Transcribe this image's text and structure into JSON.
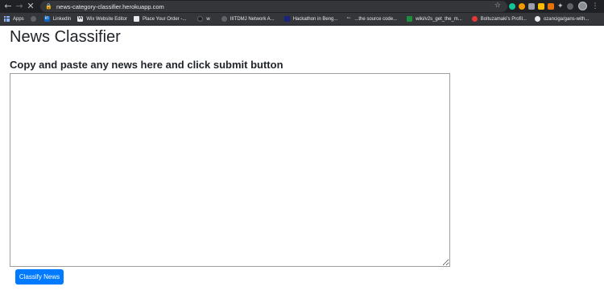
{
  "browser": {
    "url": "news-category-classifier.herokuapp.com",
    "bookmarks": [
      {
        "label": "Apps",
        "icon": "apps-grid-icon",
        "color": "#8ab4f8"
      },
      {
        "label": "",
        "icon": "globe-icon",
        "color": "#bdc1c6"
      },
      {
        "label": "LinkedIn",
        "icon": "linkedin-icon",
        "color": "#0a66c2"
      },
      {
        "label": "Wix Website Editor",
        "icon": "wix-icon",
        "color": "#ffffff"
      },
      {
        "label": "Place Your Order -...",
        "icon": "page-icon",
        "color": "#ffffff"
      },
      {
        "label": "w",
        "icon": "github-icon",
        "color": "#202124"
      },
      {
        "label": "IIITDMJ Network A...",
        "icon": "globe-icon",
        "color": "#bdc1c6"
      },
      {
        "label": "Hackathon in Beng...",
        "icon": "hackathon-icon",
        "color": "#1a237e"
      },
      {
        "label": "...the source code...",
        "icon": "bird-icon",
        "color": "#bdc1c6"
      },
      {
        "label": "wiki/v2s_get_the_m...",
        "icon": "wiki-icon",
        "color": "#1e8e3e"
      },
      {
        "label": "Boltuzamaki's Profil...",
        "icon": "kaggle-icon",
        "color": "#e53935"
      },
      {
        "label": "ozanciga/gans-with...",
        "icon": "github-icon",
        "color": "#202124"
      }
    ],
    "extensions": [
      "#34a853",
      "#f9ab00",
      "#8ab4f8",
      "#fbbc04",
      "#e8710a",
      "#8ab4f8"
    ]
  },
  "page": {
    "title": "News Classifier",
    "subtitle": "Copy and paste any news here and click submit button",
    "textarea_value": "",
    "submit_label": "Classify News",
    "accent": "#007bff"
  }
}
